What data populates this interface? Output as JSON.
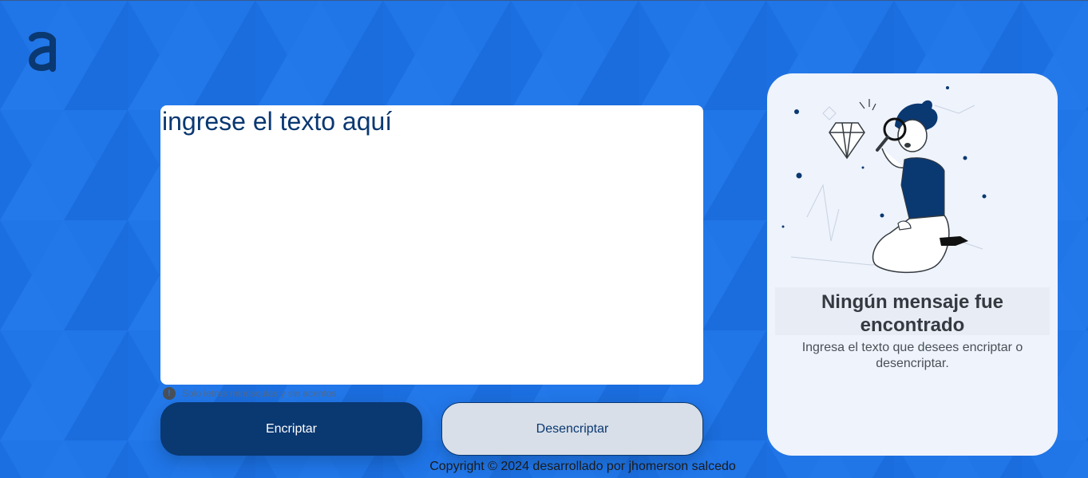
{
  "logo": {
    "letter": "a"
  },
  "input": {
    "placeholder": "ingrese el texto aquí"
  },
  "hint": {
    "icon": "info-icon",
    "text": "Solo letras minúsculas y sin acentos"
  },
  "buttons": {
    "encrypt_label": "Encriptar",
    "decrypt_label": "Desencriptar"
  },
  "footer": {
    "copyright": "Copyright © 2024 desarrollado por jhomerson salcedo"
  },
  "result_panel": {
    "title": "Ningún mensaje fue encontrado",
    "text": "Ingresa el texto que desees encriptar o desencriptar.",
    "illustration": "person-with-magnifying-glass"
  },
  "colors": {
    "background": "#1f74e6",
    "primary": "#0a3871",
    "secondary_button": "#d8dfe8",
    "panel": "#eef3fc"
  }
}
